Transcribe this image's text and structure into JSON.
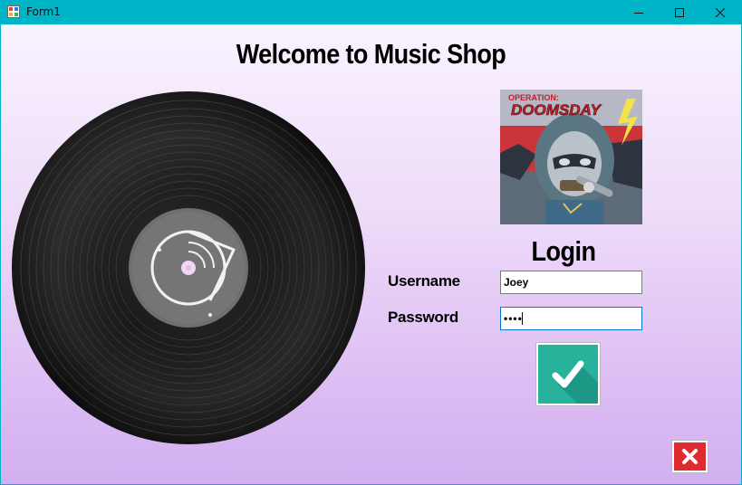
{
  "window": {
    "title": "Form1",
    "controls": {
      "minimize": "minimize-icon",
      "maximize": "maximize-icon",
      "close": "close-icon"
    }
  },
  "main": {
    "heading": "Welcome to Music Shop",
    "album": {
      "line1": "OPERATION:",
      "line2": "DOOMSDAY"
    }
  },
  "login": {
    "title": "Login",
    "username_label": "Username",
    "username_value": "Joey",
    "password_label": "Password",
    "password_value": "Joey",
    "submit_icon": "checkmark-icon",
    "exit_icon": "close-x-icon"
  },
  "colors": {
    "titlebar": "#00b4c8",
    "background_top": "#f9f3ff",
    "background_bottom": "#d2aff0",
    "submit": "#26b29b",
    "exit": "#e02a32"
  }
}
